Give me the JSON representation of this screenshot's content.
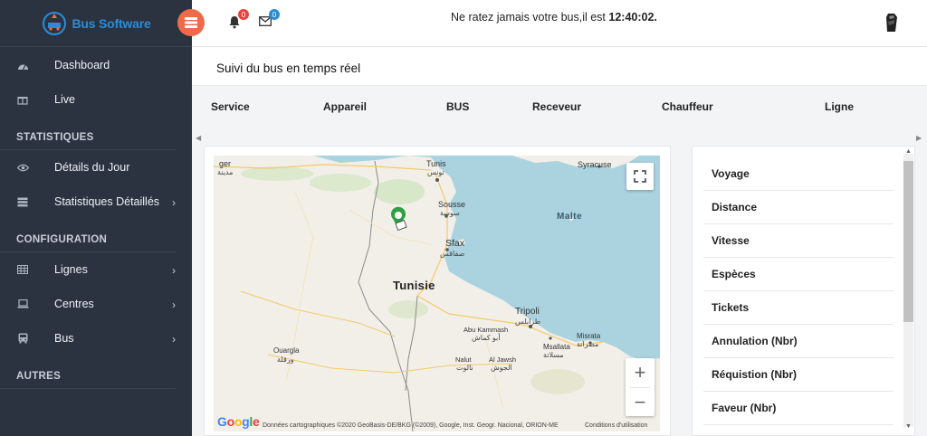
{
  "app": {
    "name": "Bus Software"
  },
  "sidebar": {
    "items_top": [
      {
        "label": "Dashboard",
        "icon": "dashboard-icon"
      },
      {
        "label": "Live",
        "icon": "gift-icon"
      }
    ],
    "sections": [
      {
        "title": "STATISTIQUES",
        "items": [
          {
            "label": "Détails du Jour",
            "icon": "eye-icon",
            "has_submenu": false
          },
          {
            "label": "Statistiques Détaillés",
            "icon": "server-icon",
            "has_submenu": true
          }
        ]
      },
      {
        "title": "CONFIGURATION",
        "items": [
          {
            "label": "Lignes",
            "icon": "grid-icon",
            "has_submenu": true
          },
          {
            "label": "Centres",
            "icon": "laptop-icon",
            "has_submenu": true
          },
          {
            "label": "Bus",
            "icon": "bus-icon",
            "has_submenu": true
          }
        ]
      },
      {
        "title": "AUTRES",
        "items": []
      }
    ]
  },
  "topbar": {
    "notifications_count": "0",
    "messages_count": "0",
    "message_prefix": "Ne ratez jamais votre bus,il est ",
    "time": "12:40:02."
  },
  "page": {
    "title": "Suivi du bus en temps réel",
    "columns": [
      "Service",
      "Appareil",
      "BUS",
      "Receveur",
      "Chauffeur",
      "Ligne"
    ]
  },
  "map": {
    "labels": {
      "country": "Tunisie",
      "sea": "Malte",
      "tunis": "Tunis",
      "tunis_ar": "تونس",
      "sousse": "Sousse",
      "sousse_ar": "سوسة",
      "sfax": "Sfax",
      "sfax_ar": "صفاقس",
      "tripoli": "Tripoli",
      "tripoli_ar": "طرابلس",
      "syracuse": "Syracuse",
      "misrata": "Misrata",
      "misrata_ar": "مصراتة",
      "msallata": "Msallata",
      "msallata_ar": "مسلاتة",
      "abukammash": "Abu Kammash",
      "abukammash_ar": "أبو كماش",
      "ouargla": "Ouargla",
      "ouargla_ar": "ورقلة",
      "nalut": "Nalut",
      "nalut_ar": "نالوت",
      "aljawsh": "Al Jawsh",
      "aljawsh_ar": "الجوش",
      "alger_ar": "مدينة",
      "alger": "ger"
    },
    "google": "Google",
    "attribution": "Données cartographiques ©2020 GeoBasis-DE/BKG (©2009), Google, Inst. Geogr. Nacional, ORION-ME",
    "conditions": "Conditions d'utilisation",
    "zoom_in": "+",
    "zoom_out": "−"
  },
  "info_rows": [
    "Voyage",
    "Distance",
    "Vitesse",
    "Espèces",
    "Tickets",
    "Annulation (Nbr)",
    "Réquistion (Nbr)",
    "Faveur (Nbr)"
  ],
  "colors": {
    "sidebar": "#2b3340",
    "accent": "#ef6a4a",
    "brand": "#2d8bd6",
    "sea": "#aad3df",
    "land": "#f2efe9"
  }
}
